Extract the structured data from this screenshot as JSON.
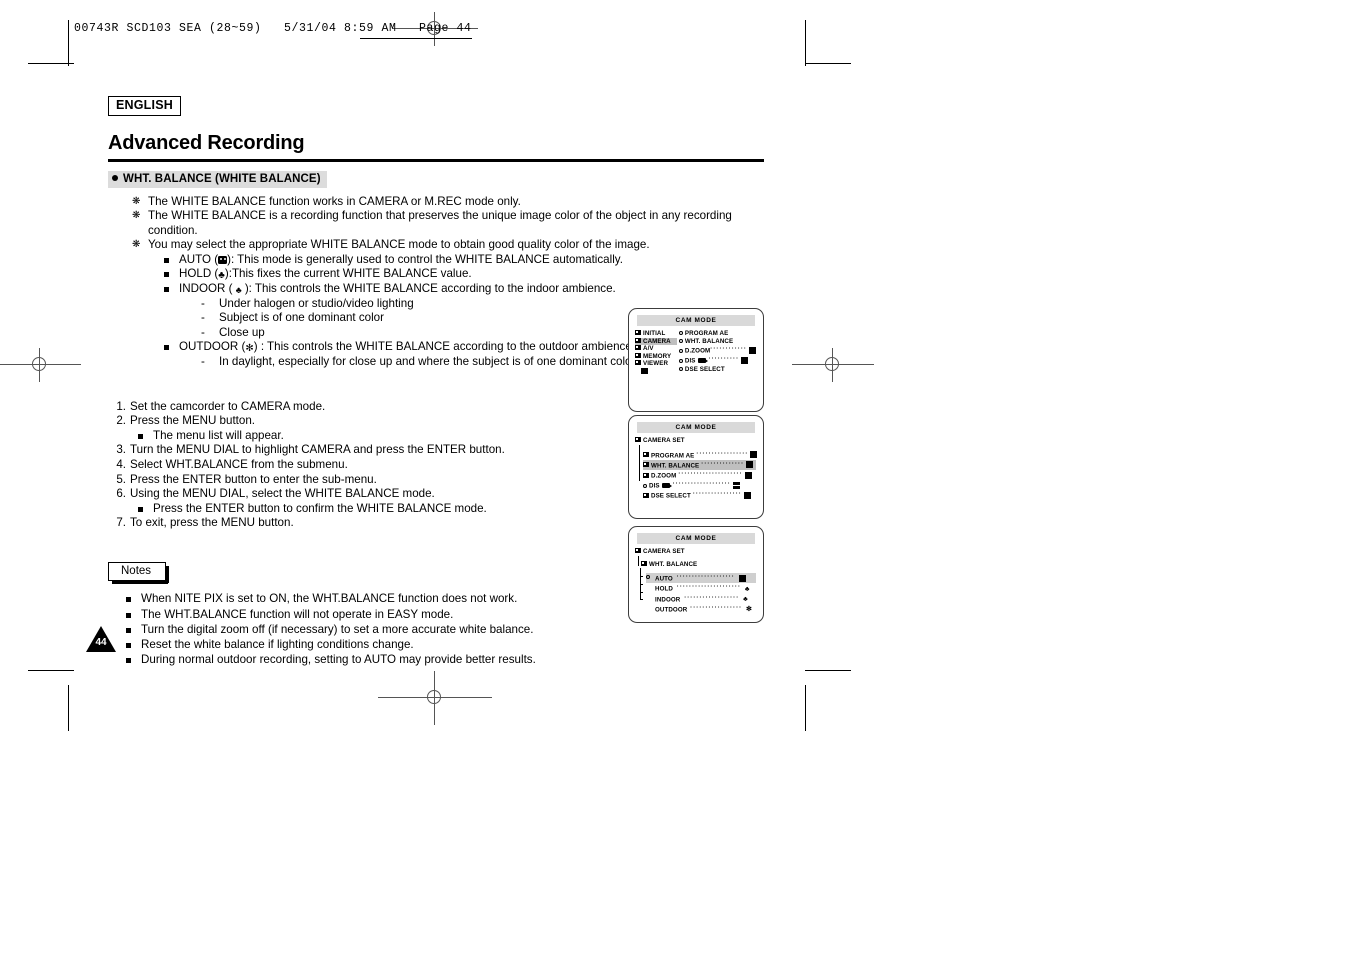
{
  "prepress": {
    "slug": "00743R SCD103 SEA (28~59)   5/31/04 8:59 AM   Page 44"
  },
  "page": {
    "language_badge": "ENGLISH",
    "chapter_title": "Advanced Recording",
    "section_heading": "WHT. BALANCE (WHITE BALANCE)",
    "page_number": "44"
  },
  "intro_bullets": [
    {
      "text": "The WHITE BALANCE function works in CAMERA or M.REC mode only."
    },
    {
      "text": "The WHITE BALANCE is a recording function that preserves the unique image color of the object in any recording condition."
    },
    {
      "text": "You may select the appropriate WHITE BALANCE mode to obtain good quality color of the image."
    }
  ],
  "modes": [
    {
      "label": "AUTO",
      "icon": "auto-wb-icon",
      "glyph": "",
      "before_paren": "AUTO (",
      "after_paren": "): This mode is generally used to control the WHITE BALANCE automatically.",
      "sub": []
    },
    {
      "label": "HOLD",
      "icon": "hold-wb-icon",
      "glyph": "♣",
      "before_paren": "HOLD (",
      "after_paren": "):This fixes the current WHITE BALANCE value.",
      "sub": []
    },
    {
      "label": "INDOOR",
      "icon": "indoor-wb-icon",
      "glyph": "♣",
      "before_paren": "INDOOR ( ",
      "after_paren": " ): This controls the WHITE BALANCE according to the indoor ambience.",
      "sub": [
        "Under halogen or studio/video lighting",
        "Subject is of one dominant color",
        "Close up"
      ]
    },
    {
      "label": "OUTDOOR",
      "icon": "outdoor-wb-icon",
      "glyph": "✻",
      "before_paren": "OUTDOOR (",
      "after_paren": ") : This controls the WHITE BALANCE according to the outdoor ambience.",
      "sub": [
        "In daylight, especially for close up and where the subject is of one dominant color."
      ]
    }
  ],
  "steps": [
    {
      "num": "1.",
      "text": "Set the camcorder to CAMERA mode.",
      "sub": []
    },
    {
      "num": "2.",
      "text": "Press the MENU button.",
      "sub": [
        "The menu list will appear."
      ]
    },
    {
      "num": "3.",
      "text": "Turn the MENU DIAL to highlight CAMERA and press the ENTER button.",
      "sub": []
    },
    {
      "num": "4.",
      "text": "Select WHT.BALANCE from the submenu.",
      "sub": []
    },
    {
      "num": "5.",
      "text": "Press the ENTER button to enter the sub-menu.",
      "sub": []
    },
    {
      "num": "6.",
      "text": "Using the MENU DIAL, select the WHITE BALANCE mode.",
      "sub": [
        "Press the ENTER button to confirm the WHITE BALANCE mode."
      ]
    },
    {
      "num": "7.",
      "text": "To exit, press the MENU button.",
      "sub": []
    }
  ],
  "notes": {
    "tab_label": "Notes",
    "items": [
      "When NITE PIX is set to ON, the WHT.BALANCE function does not work.",
      "The WHT.BALANCE function will not operate in EASY mode.",
      "Turn the digital zoom off (if necessary) to set a more accurate white balance.",
      "Reset the white balance if lighting conditions change.",
      "During normal outdoor recording, setting to AUTO may provide better results."
    ]
  },
  "lcd1": {
    "title": "CAM  MODE",
    "left_items": [
      {
        "label": "INITIAL",
        "highlighted": false
      },
      {
        "label": "CAMERA",
        "highlighted": true
      },
      {
        "label": "A/V",
        "highlighted": false
      },
      {
        "label": "MEMORY",
        "highlighted": false
      },
      {
        "label": "VIEWER",
        "highlighted": false
      }
    ],
    "right_items": [
      {
        "label": "PROGRAM AE",
        "leader": "",
        "icon": ""
      },
      {
        "label": "WHT. BALANCE",
        "leader": "",
        "icon": ""
      },
      {
        "label": "D.ZOOM",
        "leader": "············",
        "icon": "square-icon"
      },
      {
        "label": "DIS",
        "leader": "··········",
        "icon": "camera-icon"
      },
      {
        "label": "DSE SELECT",
        "leader": "",
        "icon": ""
      }
    ]
  },
  "lcd2": {
    "title": "CAM  MODE",
    "root": "CAMERA SET",
    "items": [
      {
        "label": "PROGRAM AE",
        "highlighted": false,
        "icon": "square-icon"
      },
      {
        "label": "WHT. BALANCE",
        "highlighted": true,
        "icon": "square-icon"
      },
      {
        "label": "D.ZOOM",
        "highlighted": false,
        "icon": "square-icon"
      },
      {
        "label": "DIS",
        "highlighted": false,
        "icon": "camera-icon"
      },
      {
        "label": "DSE SELECT",
        "highlighted": false,
        "icon": "square-icon"
      }
    ]
  },
  "lcd3": {
    "title": "CAM  MODE",
    "root": "CAMERA SET",
    "sub_root": "WHT. BALANCE",
    "options": [
      {
        "label": "AUTO",
        "highlighted": true,
        "icon": "auto-wb-icon",
        "glyph": "■"
      },
      {
        "label": "HOLD",
        "highlighted": false,
        "icon": "hold-wb-icon",
        "glyph": "♣"
      },
      {
        "label": "INDOOR",
        "highlighted": false,
        "icon": "indoor-wb-icon",
        "glyph": "♣"
      },
      {
        "label": "OUTDOOR",
        "highlighted": false,
        "icon": "outdoor-wb-icon",
        "glyph": "✻"
      }
    ]
  }
}
